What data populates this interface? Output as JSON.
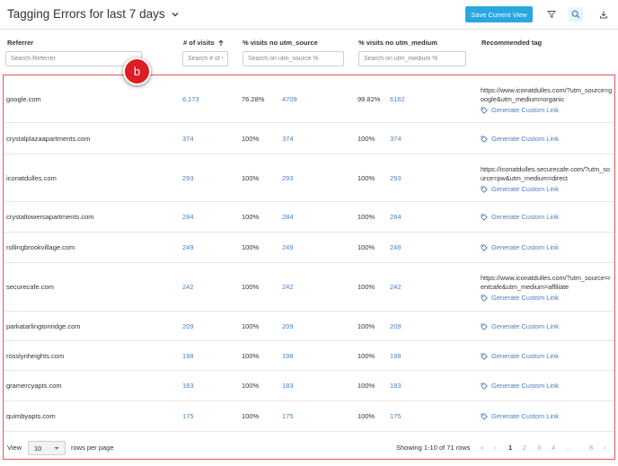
{
  "header": {
    "title": "Tagging Errors for last 7 days",
    "save_label": "Save Current View"
  },
  "columns": {
    "referrer": "Referrer",
    "visits": "# of visits",
    "utm_source": "% visits no utm_source",
    "utm_medium": "% visits no utm_medium",
    "recommended": "Recommended tag"
  },
  "search": {
    "referrer": "Search Referrer",
    "visits": "Search # of v",
    "utm_source": "Search on utm_source %",
    "utm_medium": "Search on utm_medium %"
  },
  "badge": "b",
  "generate_label": "Generate Custom Link",
  "rows": [
    {
      "referrer": "google.com",
      "visits": "6,173",
      "src_pct": "76.28%",
      "src_n": "4709",
      "med_pct": "99.82%",
      "med_n": "6162",
      "url": "https://www.iconatdulles.com/?utm_source=google&utm_medium=organic"
    },
    {
      "referrer": "crystalplazaapartments.com",
      "visits": "374",
      "src_pct": "100%",
      "src_n": "374",
      "med_pct": "100%",
      "med_n": "374",
      "url": ""
    },
    {
      "referrer": "iconatdulles.com",
      "visits": "293",
      "src_pct": "100%",
      "src_n": "293",
      "med_pct": "100%",
      "med_n": "293",
      "url": "https://iconatdulles.securecafe.com/?utm_source=pw&utm_medium=direct"
    },
    {
      "referrer": "crystaltowersapartments.com",
      "visits": "284",
      "src_pct": "100%",
      "src_n": "284",
      "med_pct": "100%",
      "med_n": "284",
      "url": ""
    },
    {
      "referrer": "rollingbrookvillage.com",
      "visits": "249",
      "src_pct": "100%",
      "src_n": "249",
      "med_pct": "100%",
      "med_n": "249",
      "url": ""
    },
    {
      "referrer": "securecafe.com",
      "visits": "242",
      "src_pct": "100%",
      "src_n": "242",
      "med_pct": "100%",
      "med_n": "242",
      "url": "https://www.iconatdulles.com/?utm_source=rentcafe&utm_medium=affiliate"
    },
    {
      "referrer": "parkatarlingtonridge.com",
      "visits": "209",
      "src_pct": "100%",
      "src_n": "209",
      "med_pct": "100%",
      "med_n": "209",
      "url": ""
    },
    {
      "referrer": "rosslynheights.com",
      "visits": "198",
      "src_pct": "100%",
      "src_n": "198",
      "med_pct": "100%",
      "med_n": "198",
      "url": ""
    },
    {
      "referrer": "gramercyapts.com",
      "visits": "183",
      "src_pct": "100%",
      "src_n": "183",
      "med_pct": "100%",
      "med_n": "183",
      "url": ""
    },
    {
      "referrer": "quimbyapts.com",
      "visits": "175",
      "src_pct": "100%",
      "src_n": "175",
      "med_pct": "100%",
      "med_n": "175",
      "url": ""
    }
  ],
  "footer": {
    "view_label": "View",
    "per_page_value": "10",
    "rows_per_page": "rows per page",
    "showing": "Showing 1-10 of 71 rows",
    "pages": [
      "«",
      "‹",
      "1",
      "2",
      "3",
      "4",
      "…",
      "8",
      "›"
    ]
  },
  "icons": {
    "title": "chevron-down-icon",
    "filter": "filter-icon",
    "search": "search-icon",
    "download": "download-icon",
    "sort": "sort-ascending-icon",
    "tag": "tag-icon"
  },
  "colors": {
    "accent": "#29a8e0",
    "link": "#4a7fc1",
    "highlight": "#e8525a",
    "badge": "#dc1d24"
  }
}
